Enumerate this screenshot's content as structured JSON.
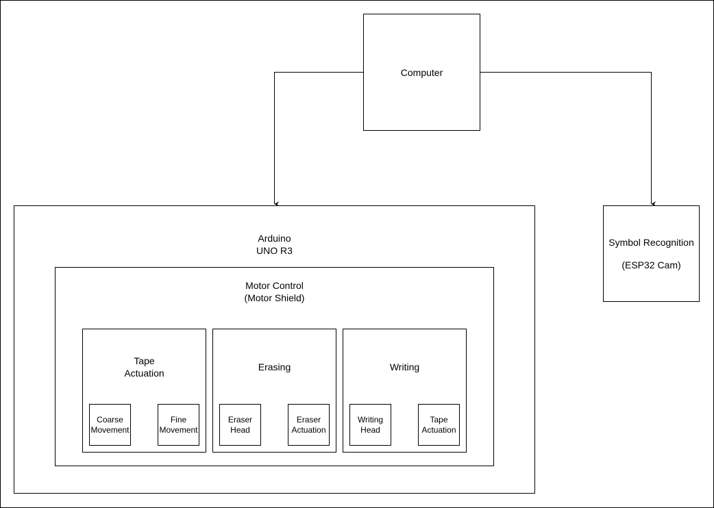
{
  "diagram": {
    "computer": {
      "label": "Computer"
    },
    "symbol_recognition": {
      "line1": "Symbol Recognition",
      "line2": "(ESP32 Cam)"
    },
    "arduino": {
      "line1": "Arduino",
      "line2": "UNO R3",
      "motor_control": {
        "line1": "Motor Control",
        "line2": "(Motor Shield)",
        "groups": [
          {
            "line1": "Tape",
            "line2": "Actuation",
            "children": [
              {
                "line1": "Coarse",
                "line2": "Movement"
              },
              {
                "line1": "Fine",
                "line2": "Movement"
              }
            ]
          },
          {
            "line1": "Erasing",
            "line2": "",
            "children": [
              {
                "line1": "Eraser",
                "line2": "Head"
              },
              {
                "line1": "Eraser",
                "line2": "Actuation"
              }
            ]
          },
          {
            "line1": "Writing",
            "line2": "",
            "children": [
              {
                "line1": "Writing",
                "line2": "Head"
              },
              {
                "line1": "Tape",
                "line2": "Actuation"
              }
            ]
          }
        ]
      }
    },
    "connections": [
      {
        "from": "Computer",
        "to": "Arduino UNO R3"
      },
      {
        "from": "Computer",
        "to": "Symbol Recognition (ESP32 Cam)"
      }
    ]
  }
}
